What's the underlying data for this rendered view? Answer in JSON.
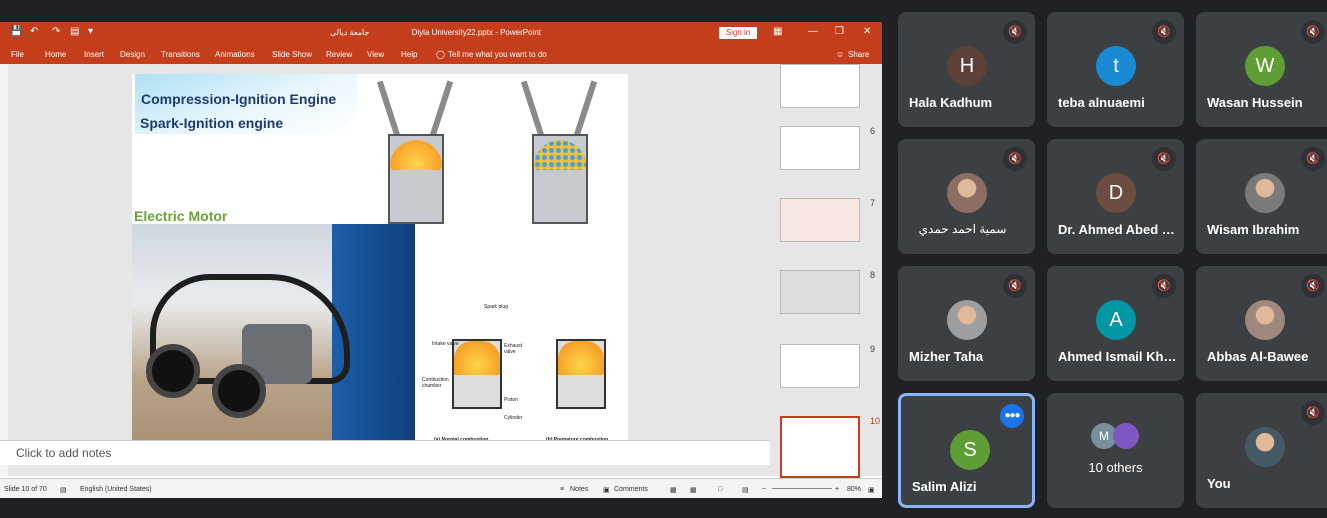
{
  "ppt": {
    "quick_access": [
      "save-icon",
      "undo-icon",
      "redo-icon",
      "present-icon",
      "customize-icon"
    ],
    "title_arabic": "جامعة ديالى",
    "title": "Diyla University22.pptx  -  PowerPoint",
    "sign_in": "Sign in",
    "tabs": [
      "File",
      "Home",
      "Insert",
      "Design",
      "Transitions",
      "Animations",
      "Slide Show",
      "Review",
      "View",
      "Help"
    ],
    "tell_me": "Tell me what you want to do",
    "share": "Share",
    "slide": {
      "line1": "Compression-Ignition Engine",
      "line2": "Spark-Ignition engine",
      "heading": "Electric Motor",
      "labels": {
        "spark_plug": "Spark plug",
        "intake_valve": "Intake valve",
        "exhaust_valve": "Exhaust valve",
        "combustion_chamber": "Combustion chamber",
        "piston": "Piston",
        "cylinder": "Cylinder",
        "cap_a": "(a) Normal combustion",
        "cap_b": "(b) Premature combustion"
      }
    },
    "notes_placeholder": "Click to add notes",
    "thumbnails": [
      "",
      "6",
      "7",
      "8",
      "9",
      "10"
    ],
    "status": {
      "slide_count": "Slide 10 of 70",
      "language": "English (United States)",
      "notes": "Notes",
      "comments": "Comments",
      "zoom": "80%"
    }
  },
  "participants": [
    {
      "name": "Hala Kadhum",
      "initial": "H",
      "color": "#5d4037",
      "muted": true
    },
    {
      "name": "teba alnuaemi",
      "initial": "t",
      "color": "#1a8ad4",
      "muted": true
    },
    {
      "name": "Wasan Hussein",
      "initial": "W",
      "color": "#5f9e35",
      "muted": true
    },
    {
      "name": "سمية احمد حمدي",
      "initial": "",
      "color": "#8d6e63",
      "muted": true
    },
    {
      "name": "Dr. Ahmed Abed Mohammed",
      "initial": "D",
      "color": "#6d4c41",
      "muted": true
    },
    {
      "name": "Wisam Ibrahim",
      "initial": "",
      "color": "#7a7a7a",
      "muted": true
    },
    {
      "name": "Mizher Taha",
      "initial": "",
      "color": "#9e9e9e",
      "muted": true
    },
    {
      "name": "Ahmed Ismail Khalil",
      "initial": "A",
      "color": "#0097a7",
      "muted": true
    },
    {
      "name": "Abbas Al-Bawee",
      "initial": "",
      "color": "#a1887f",
      "muted": true
    },
    {
      "name": "Salim Alizi",
      "initial": "S",
      "color": "#5f9e35",
      "muted": false
    },
    {
      "name": "10 others",
      "initial": "M",
      "color": "#78909c",
      "muted": false
    },
    {
      "name": "You",
      "initial": "",
      "color": "#455a64",
      "muted": true
    }
  ]
}
